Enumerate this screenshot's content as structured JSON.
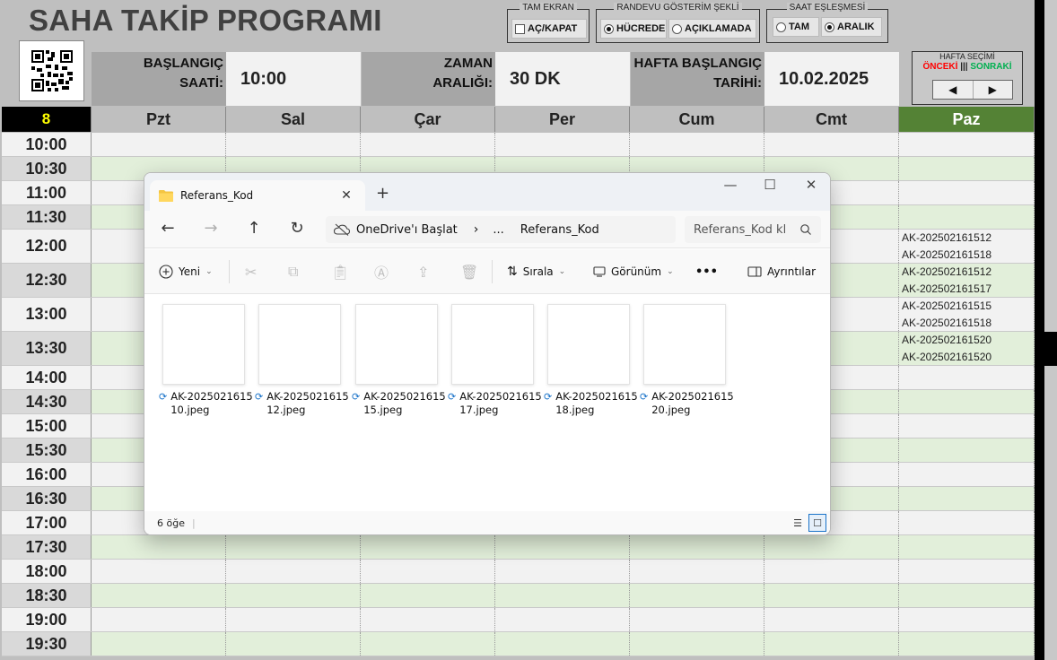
{
  "app": {
    "title": "SAHA TAKİP PROGRAMI"
  },
  "controls": {
    "fullscreen": {
      "title": "TAM EKRAN",
      "label": "AÇ/KAPAT",
      "checked": false
    },
    "display_mode": {
      "title": "RANDEVU GÖSTERİM ŞEKLİ",
      "options": [
        "HÜCREDE",
        "AÇIKLAMADA"
      ],
      "selected": "HÜCREDE"
    },
    "time_match": {
      "title": "SAAT EŞLEŞMESİ",
      "options": [
        "TAM",
        "ARALIK"
      ],
      "selected": "ARALIK"
    },
    "week_select": {
      "title": "HAFTA SEÇİMİ",
      "prev": "ÖNCEKİ",
      "divider": "|||",
      "next": "SONRAKİ",
      "prev_color": "#ff0000",
      "next_color": "#00b050"
    }
  },
  "info": {
    "start_time_label_1": "BAŞLANGIÇ",
    "start_time_label_2": "SAATİ:",
    "start_time_value": "10:00",
    "interval_label_1": "ZAMAN",
    "interval_label_2": "ARALIĞI:",
    "interval_value": "30 DK",
    "week_start_label_1": "HAFTA BAŞLANGIÇ",
    "week_start_label_2": "TARİHİ:",
    "week_start_value": "10.02.2025"
  },
  "schedule": {
    "week_number": "8",
    "days": [
      "Pzt",
      "Sal",
      "Çar",
      "Per",
      "Cum",
      "Cmt",
      "Paz"
    ],
    "times": [
      "10:00",
      "10:30",
      "11:00",
      "11:30",
      "12:00",
      "12:30",
      "13:00",
      "13:30",
      "14:00",
      "14:30",
      "15:00",
      "15:30",
      "16:00",
      "16:30",
      "17:00",
      "17:30",
      "18:00",
      "18:30",
      "19:00",
      "19:30"
    ],
    "sunday_entries": {
      "12:00": [
        "AK-202502161512",
        "AK-202502161518"
      ],
      "12:30": [
        "AK-202502161512",
        "AK-202502161517"
      ],
      "13:00": [
        "AK-202502161515",
        "AK-202502161518"
      ],
      "13:30": [
        "AK-202502161520",
        "AK-202502161520"
      ]
    },
    "colors": {
      "sunday_header": "#548235",
      "week_number_bg": "#000000",
      "week_number_fg": "#ffff00",
      "alt_row": "#e2efda"
    }
  },
  "explorer": {
    "tab_title": "Referans_Kod",
    "path": [
      "OneDrive'ı Başlat",
      "...",
      "Referans_Kod"
    ],
    "search_placeholder": "Referans_Kod kl",
    "commands": {
      "new": "Yeni",
      "sort": "Sırala",
      "view": "Görünüm",
      "more": "•••",
      "details": "Ayrıntılar"
    },
    "files": [
      {
        "line1": "AK-2025021615",
        "line2": "10.jpeg"
      },
      {
        "line1": "AK-2025021615",
        "line2": "12.jpeg"
      },
      {
        "line1": "AK-2025021615",
        "line2": "15.jpeg"
      },
      {
        "line1": "AK-2025021615",
        "line2": "17.jpeg"
      },
      {
        "line1": "AK-2025021615",
        "line2": "18.jpeg"
      },
      {
        "line1": "AK-2025021615",
        "line2": "20.jpeg"
      }
    ],
    "status": "6 öğe"
  }
}
